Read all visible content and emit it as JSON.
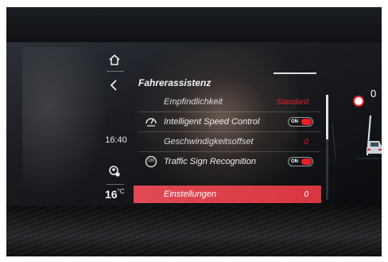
{
  "sidebar": {
    "home_icon": "home-icon",
    "back_icon": "chevron-left-icon",
    "clock": "16:40",
    "profile_icon": "driver-profile-icon",
    "temperature": "16",
    "temperature_unit": "°C"
  },
  "menu": {
    "title": "Fahrerassistenz",
    "rows": [
      {
        "label": "Empfindlichkeit",
        "value": "Standard",
        "type": "sub"
      },
      {
        "label": "Intelligent Speed Control",
        "toggle": "ON",
        "icon": "speed-control-icon",
        "type": "main"
      },
      {
        "label": "Geschwindigkeitsoffset",
        "value": "0",
        "type": "sub"
      },
      {
        "label": "Traffic Sign Recognition",
        "toggle": "ON",
        "icon": "traffic-sign-icon",
        "icon_text": "120",
        "type": "main"
      },
      {
        "label": "Einstellungen",
        "value": "0",
        "type": "sub",
        "selected": true
      }
    ]
  },
  "cluster": {
    "speed": "0"
  },
  "colors": {
    "accent_red": "#e8202a",
    "selected_row": "#d8363f",
    "text": "#eeeeee"
  }
}
